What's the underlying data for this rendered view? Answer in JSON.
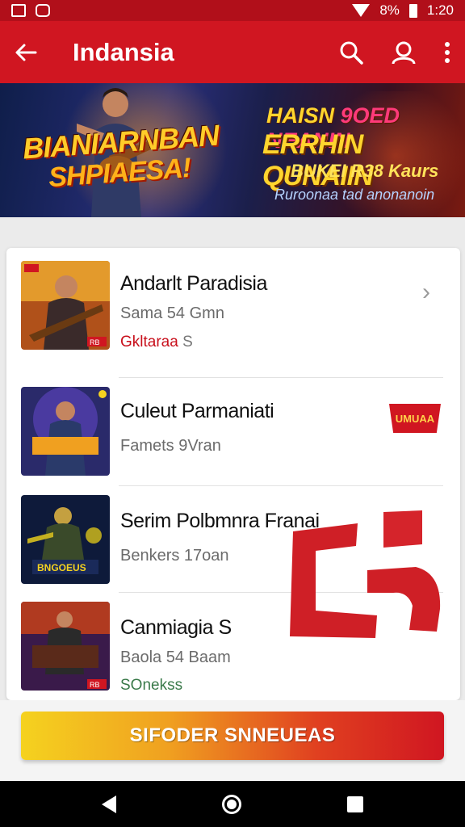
{
  "status_bar": {
    "time": "1:20",
    "signal_text": "8%"
  },
  "app_bar": {
    "title": "Indansia",
    "icons": [
      "back-arrow-icon",
      "search-icon",
      "account-icon",
      "more-vert-icon"
    ]
  },
  "banner": {
    "title_line1": "BIANIARNBAN",
    "title_line2": "SHPIAESA!",
    "right_line1_a": "HAISN",
    "right_line1_b": "9OED NEANIN",
    "right_line2": "ERRHIN QUNAIIN",
    "right_line3": "BUKEI R38 Kaurs",
    "right_line4": "Ruroonaa tad anonanoin"
  },
  "list": {
    "items": [
      {
        "title": "Andarlt Paradisia",
        "subtitle": "Sama 54 Gmn",
        "meta": "Gkltaraa",
        "meta_extra": "S",
        "thumb_badge": "RB"
      },
      {
        "title": "Culeut Parmaniati",
        "subtitle": "Famets 9Vran",
        "tag": "UMUAA"
      },
      {
        "title": "Serim Polbmnra Franai",
        "subtitle": "Benkers 17oan",
        "thumb_caption": "BNGOEUS"
      },
      {
        "title": "Canmiagia S",
        "subtitle": "Baola 54 Baam",
        "meta": "SOnekss",
        "thumb_badge": "RB"
      }
    ]
  },
  "cta": {
    "label": "SIFODER SNNEUEAS"
  },
  "colors": {
    "primary": "#d01621",
    "status": "#b10f1a",
    "accent_yellow": "#f5d21f"
  }
}
